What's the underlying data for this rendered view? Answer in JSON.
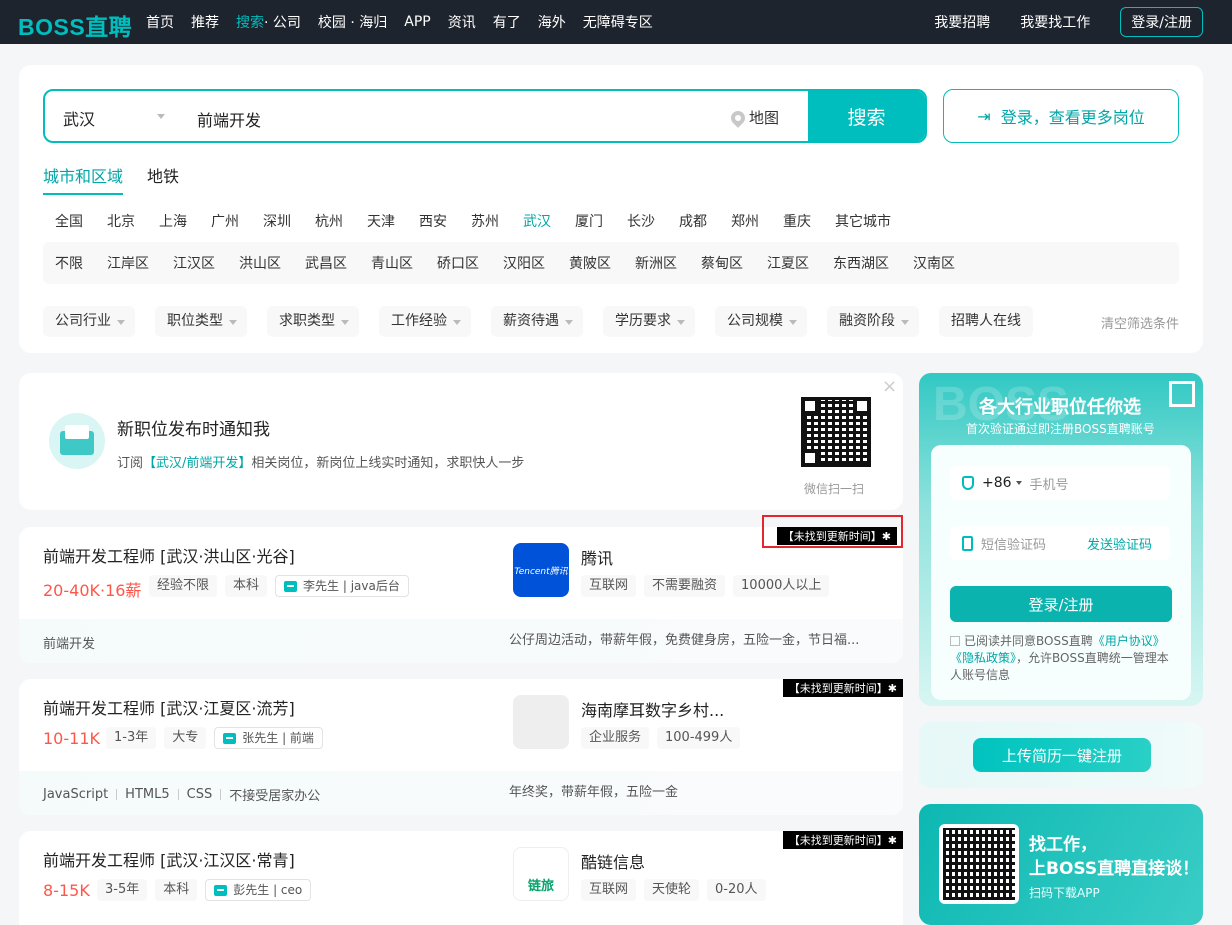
{
  "brand": {
    "logo": "BOSS直聘",
    "accent": "#00bebd"
  },
  "nav": {
    "items": [
      "首页",
      "推荐",
      "搜索",
      "校园 · 海归",
      "APP",
      "资讯",
      "有了",
      "海外",
      "无障碍专区"
    ],
    "search_sub": "· 公司",
    "right_links": [
      "我要招聘",
      "我要找工作"
    ],
    "login": "登录/注册"
  },
  "search": {
    "city": "武汉",
    "query": "前端开发",
    "map_label": "地图",
    "button": "搜索",
    "login_more": "登录，查看更多岗位"
  },
  "area_tabs": [
    "城市和区域",
    "地铁"
  ],
  "cities": [
    "全国",
    "北京",
    "上海",
    "广州",
    "深圳",
    "杭州",
    "天津",
    "西安",
    "苏州",
    "武汉",
    "厦门",
    "长沙",
    "成都",
    "郑州",
    "重庆",
    "其它城市"
  ],
  "districts": [
    "不限",
    "江岸区",
    "江汉区",
    "洪山区",
    "武昌区",
    "青山区",
    "硚口区",
    "汉阳区",
    "黄陂区",
    "新洲区",
    "蔡甸区",
    "江夏区",
    "东西湖区",
    "汉南区"
  ],
  "filters": [
    "公司行业",
    "职位类型",
    "求职类型",
    "工作经验",
    "薪资待遇",
    "学历要求",
    "公司规模",
    "融资阶段",
    "招聘人在线"
  ],
  "clear_filters": "清空筛选条件",
  "notify": {
    "title": "新职位发布时通知我",
    "desc_prefix": "订阅",
    "desc_highlight": "【武汉/前端开发】",
    "desc_suffix": "相关岗位，新岗位上线实时通知，求职快人一步",
    "qr_caption": "微信扫一扫",
    "close": "×"
  },
  "jobs": [
    {
      "title": "前端开发工程师  [武汉·洪山区·光谷]",
      "salary": "20-40K·16薪",
      "tags": [
        "经验不限",
        "本科"
      ],
      "recruiter": "李先生 | java后台",
      "company": "腾讯",
      "company_tags": [
        "互联网",
        "不需要融资",
        "10000人以上"
      ],
      "skills": [
        "前端开发"
      ],
      "welfare": "公仔周边活动，带薪年假，免费健身房，五险一金，节日福...",
      "badge": "【未找到更新时间】✱",
      "logo_text": "Tencent腾讯"
    },
    {
      "title": "前端开发工程师  [武汉·江夏区·流芳]",
      "salary": "10-11K",
      "tags": [
        "1-3年",
        "大专"
      ],
      "recruiter": "张先生 | 前端",
      "company": "海南摩耳数字乡村...",
      "company_tags": [
        "企业服务",
        "100-499人"
      ],
      "skills": [
        "JavaScript",
        "HTML5",
        "CSS",
        "不接受居家办公"
      ],
      "welfare": "年终奖，带薪年假，五险一金",
      "badge": "【未找到更新时间】✱",
      "logo_text": ""
    },
    {
      "title": "前端开发工程师  [武汉·江汉区·常青]",
      "salary": "8-15K",
      "tags": [
        "3-5年",
        "本科"
      ],
      "recruiter": "彭先生 | ceo",
      "company": "酷链信息",
      "company_tags": [
        "互联网",
        "天使轮",
        "0-20人"
      ],
      "badge": "【未找到更新时间】✱",
      "logo_text": "链旅"
    }
  ],
  "register": {
    "bg_text": "BOSS",
    "title": "各大行业职位任你选",
    "subtitle": "首次验证通过即注册BOSS直聘账号",
    "country_code": "+86",
    "phone_placeholder": "手机号",
    "code_placeholder": "短信验证码",
    "send_code": "发送验证码",
    "button": "登录/注册",
    "agree_prefix": "已阅读并同意BOSS直聘",
    "agree_user": "《用户协议》",
    "agree_privacy": "《隐私政策》",
    "agree_suffix": "，允许BOSS直聘统一管理本人账号信息"
  },
  "upload": {
    "button": "上传简历一键注册"
  },
  "app_promo": {
    "line1": "找工作，",
    "line2": "上BOSS直聘直接谈！",
    "line3": "扫码下载APP"
  }
}
